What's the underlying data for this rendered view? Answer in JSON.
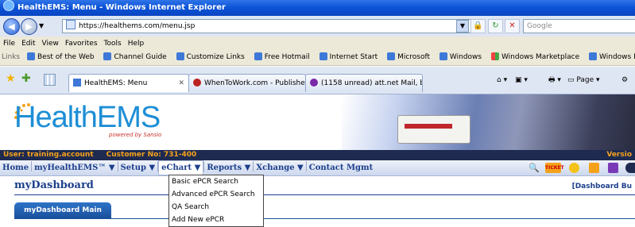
{
  "window": {
    "title": "HealthEMS: Menu - Windows Internet Explorer"
  },
  "address": {
    "url": "https://healthems.com/menu.jsp",
    "search_placeholder": "Google"
  },
  "menubar": [
    "File",
    "Edit",
    "View",
    "Favorites",
    "Tools",
    "Help"
  ],
  "links": {
    "label": "Links",
    "items": [
      "Best of the Web",
      "Channel Guide",
      "Customize Links",
      "Free Hotmail",
      "Internet Start",
      "Microsoft",
      "Windows",
      "Windows Marketplace",
      "Windows Media"
    ]
  },
  "tabs": [
    {
      "label": "HealthEMS: Menu"
    },
    {
      "label": "WhenToWork.com - Publishe..."
    },
    {
      "label": "(1158 unread) att.net Mail, b..."
    }
  ],
  "ie_commands": {
    "page": "Page"
  },
  "site": {
    "logo": "HealthEMS",
    "powered": "powered by Sansio",
    "user": "User: training.account",
    "customer": "Customer No: 731-400",
    "version": "Versio"
  },
  "nav": [
    "Home",
    "myHealthEMS™ ▼",
    "Setup ▼",
    "eChart ▼",
    "Reports ▼",
    "Xchange ▼",
    "Contact Mgmt"
  ],
  "nav_icons": {
    "ticket": "TICKET"
  },
  "dashboard": {
    "title": "myDashboard",
    "link": "[Dashboard Bu",
    "tab": "myDashboard Main"
  },
  "dropdown": [
    "Basic ePCR Search",
    "Advanced ePCR Search",
    "QA Search",
    "Add New ePCR"
  ]
}
